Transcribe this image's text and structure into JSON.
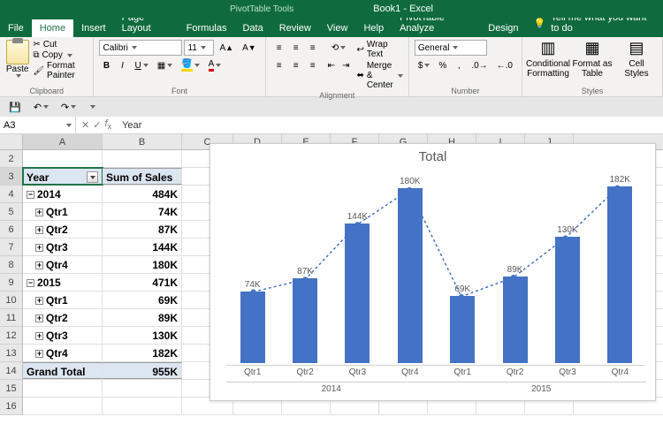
{
  "titlebar": {
    "contextTool": "PivotTable Tools",
    "book": "Book1 - Excel"
  },
  "tabs": {
    "file": "File",
    "home": "Home",
    "insert": "Insert",
    "pageLayout": "Page Layout",
    "formulas": "Formulas",
    "data": "Data",
    "review": "Review",
    "view": "View",
    "help": "Help",
    "analyze": "PivotTable Analyze",
    "design": "Design",
    "tellme": "Tell me what you want to do"
  },
  "ribbon": {
    "clipboard": {
      "paste": "Paste",
      "cut": "Cut",
      "copy": "Copy",
      "formatPainter": "Format Painter",
      "label": "Clipboard"
    },
    "font": {
      "name": "Calibri",
      "size": "11",
      "bold": "B",
      "italic": "I",
      "underline": "U",
      "label": "Font"
    },
    "alignment": {
      "wrap": "Wrap Text",
      "merge": "Merge & Center",
      "label": "Alignment"
    },
    "number": {
      "format": "General",
      "label": "Number",
      "sym": "$",
      "pct": "%",
      "comma": ","
    },
    "styles": {
      "cond": "Conditional Formatting",
      "fmtTable": "Format as Table",
      "cellStyles": "Cell Styles",
      "label": "Styles"
    }
  },
  "namebox": "A3",
  "formula": "Year",
  "colWidths": {
    "A": 90,
    "B": 90,
    "C": 58,
    "D": 55,
    "E": 55,
    "F": 55,
    "G": 55,
    "H": 55,
    "I": 55,
    "J": 55
  },
  "columns": [
    "A",
    "B",
    "C",
    "D",
    "E",
    "F",
    "G",
    "H",
    "I",
    "J"
  ],
  "pivot": {
    "headerA": "Year",
    "headerB": "Sum of Sales",
    "rows": [
      {
        "level": 0,
        "label": "2014",
        "val": "484K",
        "exp": "−",
        "b": true
      },
      {
        "level": 1,
        "label": "Qtr1",
        "val": "74K",
        "exp": "+",
        "b": true
      },
      {
        "level": 1,
        "label": "Qtr2",
        "val": "87K",
        "exp": "+",
        "b": true
      },
      {
        "level": 1,
        "label": "Qtr3",
        "val": "144K",
        "exp": "+",
        "b": true
      },
      {
        "level": 1,
        "label": "Qtr4",
        "val": "180K",
        "exp": "+",
        "b": true
      },
      {
        "level": 0,
        "label": "2015",
        "val": "471K",
        "exp": "−",
        "b": true
      },
      {
        "level": 1,
        "label": "Qtr1",
        "val": "69K",
        "exp": "+",
        "b": true
      },
      {
        "level": 1,
        "label": "Qtr2",
        "val": "89K",
        "exp": "+",
        "b": true
      },
      {
        "level": 1,
        "label": "Qtr3",
        "val": "130K",
        "exp": "+",
        "b": true
      },
      {
        "level": 1,
        "label": "Qtr4",
        "val": "182K",
        "exp": "+",
        "b": true
      }
    ],
    "grandA": "Grand Total",
    "grandB": "955K"
  },
  "chart_data": {
    "type": "bar",
    "title": "Total",
    "series": [
      {
        "name": "bars",
        "values": [
          74,
          87,
          144,
          180,
          69,
          89,
          130,
          182
        ]
      },
      {
        "name": "line",
        "values": [
          74,
          87,
          144,
          180,
          69,
          89,
          130,
          182
        ]
      }
    ],
    "categories": [
      "Qtr1",
      "Qtr2",
      "Qtr3",
      "Qtr4",
      "Qtr1",
      "Qtr2",
      "Qtr3",
      "Qtr4"
    ],
    "groups": [
      "2014",
      "2015"
    ],
    "labelsSuffix": "K",
    "ylim": [
      0,
      200
    ]
  }
}
